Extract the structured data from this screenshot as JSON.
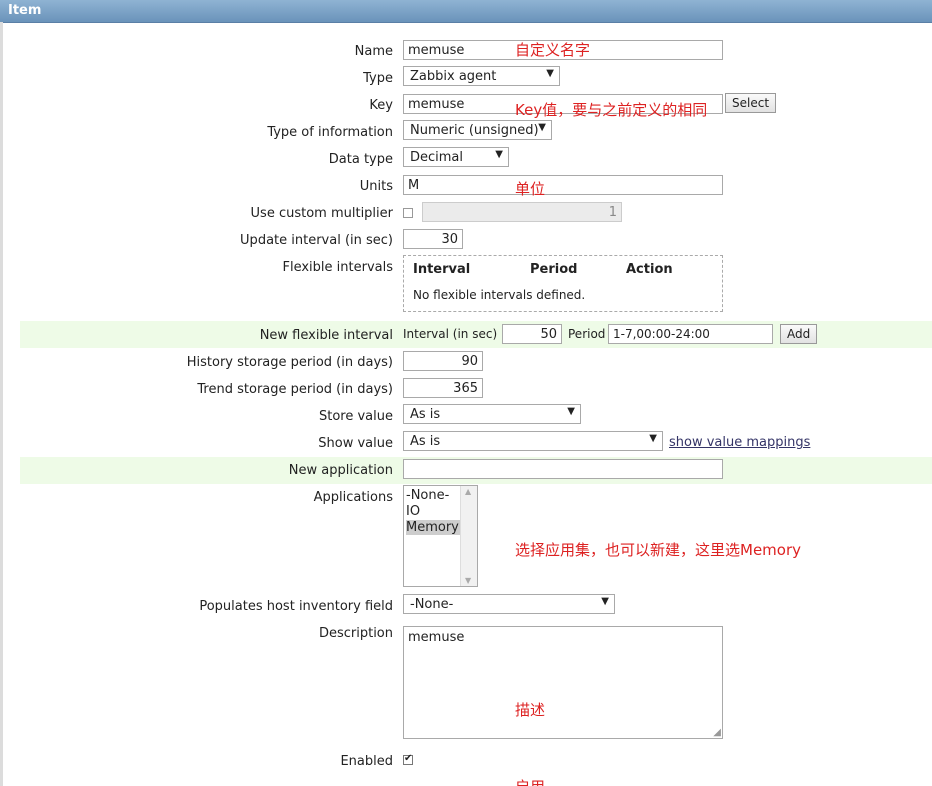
{
  "header": {
    "title": "Item"
  },
  "form": {
    "name": {
      "label": "Name",
      "value": "memuse"
    },
    "type": {
      "label": "Type",
      "value": "Zabbix agent"
    },
    "key": {
      "label": "Key",
      "value": "memuse",
      "select_label": "Select"
    },
    "type_of_information": {
      "label": "Type of information",
      "value": "Numeric (unsigned)"
    },
    "data_type": {
      "label": "Data type",
      "value": "Decimal"
    },
    "units": {
      "label": "Units",
      "value": "M"
    },
    "custom_multiplier": {
      "label": "Use custom multiplier",
      "checked": false,
      "value": "1"
    },
    "update_interval": {
      "label": "Update interval (in sec)",
      "value": "30"
    },
    "flexible_intervals": {
      "label": "Flexible intervals",
      "columns": [
        "Interval",
        "Period",
        "Action"
      ],
      "empty_text": "No flexible intervals defined."
    },
    "new_flexible_interval": {
      "label": "New flexible interval",
      "interval_label": "Interval (in sec)",
      "interval_value": "50",
      "period_label": "Period",
      "period_value": "1-7,00:00-24:00",
      "add_label": "Add"
    },
    "history": {
      "label": "History storage period (in days)",
      "value": "90"
    },
    "trend": {
      "label": "Trend storage period (in days)",
      "value": "365"
    },
    "store_value": {
      "label": "Store value",
      "value": "As is"
    },
    "show_value": {
      "label": "Show value",
      "value": "As is",
      "link": "show value mappings"
    },
    "new_application": {
      "label": "New application",
      "value": ""
    },
    "applications": {
      "label": "Applications",
      "options": [
        "-None-",
        "IO",
        "Memory"
      ],
      "selected": "Memory"
    },
    "inventory": {
      "label": "Populates host inventory field",
      "value": "-None-"
    },
    "description": {
      "label": "Description",
      "value": "memuse"
    },
    "enabled": {
      "label": "Enabled",
      "checked": true
    }
  },
  "annotations": {
    "name_note": "自定义名字",
    "key_note": "Key值，要与之前定义的相同",
    "units_note": "单位",
    "applications_note": "选择应用集，也可以新建，这里选Memory",
    "description_note": "描述",
    "enabled_note": "启用"
  },
  "colors": {
    "header": "#7aa0c4",
    "highlight_row": "#eefbe7",
    "annotation": "#dd2222",
    "link": "#333366"
  }
}
